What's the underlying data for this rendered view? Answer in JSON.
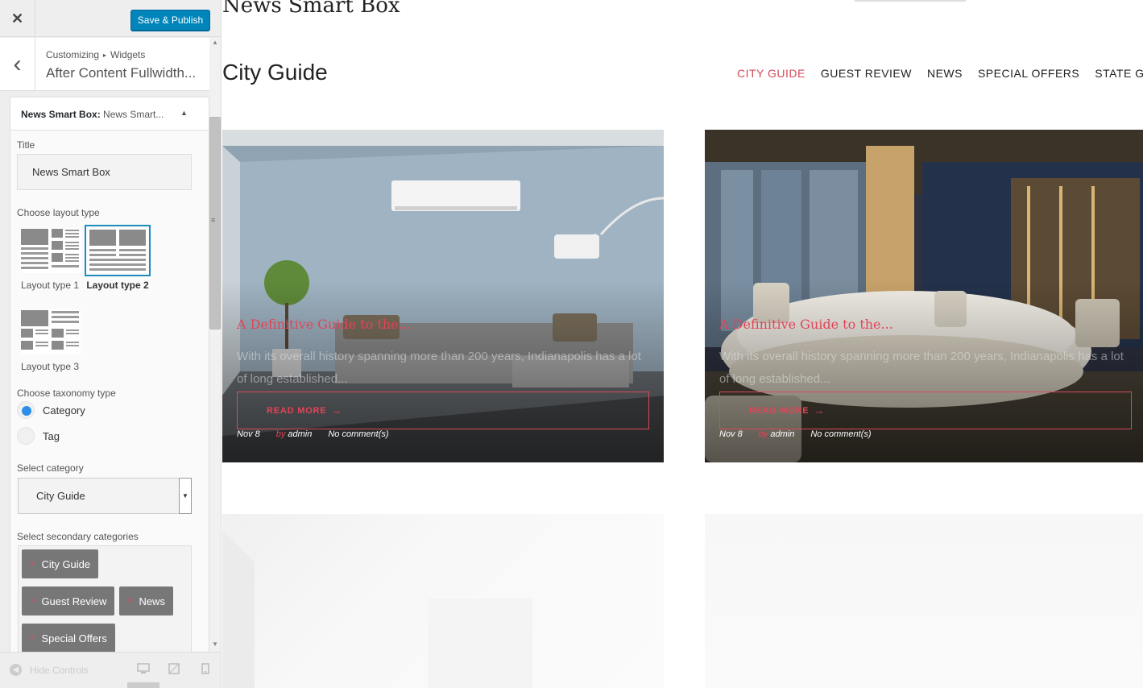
{
  "topbar": {
    "close_glyph": "✕",
    "publish_label": "Save & Publish"
  },
  "header": {
    "back_glyph": "‹",
    "breadcrumb": [
      "Customizing",
      "Widgets"
    ],
    "breadcrumb_sep": "▸",
    "title": "After Content Fullwidth..."
  },
  "widget": {
    "head_prefix": "News Smart Box:",
    "head_name": "News Smart...",
    "toggle_glyph": "▲",
    "title_label": "Title",
    "title_value": "News Smart Box",
    "layout_label": "Choose layout type",
    "layouts": [
      {
        "label": "Layout type 1",
        "selected": false
      },
      {
        "label": "Layout type 2",
        "selected": true
      },
      {
        "label": "Layout type 3",
        "selected": false
      }
    ],
    "taxonomy_label": "Choose taxonomy type",
    "taxonomy_options": [
      {
        "label": "Category",
        "checked": true
      },
      {
        "label": "Tag",
        "checked": false
      }
    ],
    "category_label": "Select category",
    "category_value": "City Guide",
    "category_arrow": "▼",
    "secondary_label": "Select secondary categories",
    "secondary_tags": [
      "City Guide",
      "Guest Review",
      "News",
      "Special Offers"
    ],
    "tag_remove_glyph": "×"
  },
  "footer": {
    "hide_label": "Hide Controls"
  },
  "preview": {
    "widget_title": "News Smart Box",
    "box_title": "City Guide",
    "nav": [
      "CITY GUIDE",
      "GUEST REVIEW",
      "NEWS",
      "SPECIAL OFFERS",
      "STATE GUIDE"
    ],
    "active_nav": 0,
    "accent_color": "#e24457",
    "cards": [
      {
        "title": "A Definitive Guide to the...",
        "excerpt": "With its overall history spanning more than 200 years, Indianapolis has a lot of long established...",
        "button": "READ MORE",
        "date": "Nov 8",
        "by": "by",
        "author": "admin",
        "comments": "No comment(s)"
      },
      {
        "title": "A Definitive Guide to the...",
        "excerpt": "With its overall history spanning more than 200 years, Indianapolis has a lot of long established...",
        "button": "READ MORE",
        "date": "Nov 8",
        "by": "by",
        "author": "admin",
        "comments": "No comment(s)"
      }
    ]
  }
}
